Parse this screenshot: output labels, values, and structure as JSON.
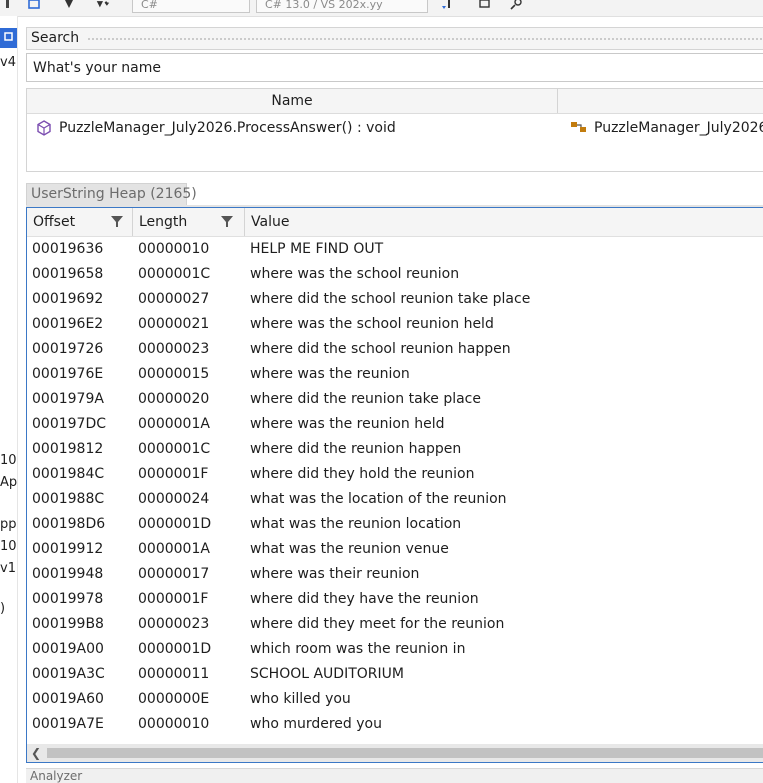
{
  "toolbar": {
    "language_select": "C#",
    "version_select": "C# 13.0 / VS 202x.yy"
  },
  "left_panel": {
    "fragments": [
      "v4.",
      "10.",
      "Ap",
      "pp",
      "10",
      "v1",
      ")"
    ]
  },
  "search": {
    "label": "Search",
    "value": "What's your name"
  },
  "results": {
    "column_name": "Name",
    "rows": [
      {
        "member": "PuzzleManager_July2026.ProcessAnswer() : void",
        "type": "PuzzleManager_July2026"
      }
    ]
  },
  "heap": {
    "tab_label": "UserString Heap (2165)",
    "columns": [
      "Offset",
      "Length",
      "Value"
    ],
    "rows": [
      {
        "offset": "00019636",
        "length": "00000010",
        "value": "HELP ME FIND OUT"
      },
      {
        "offset": "00019658",
        "length": "0000001C",
        "value": "where was the school reunion"
      },
      {
        "offset": "00019692",
        "length": "00000027",
        "value": "where did the school reunion take place"
      },
      {
        "offset": "000196E2",
        "length": "00000021",
        "value": "where was the school reunion held"
      },
      {
        "offset": "00019726",
        "length": "00000023",
        "value": "where did the school reunion happen"
      },
      {
        "offset": "0001976E",
        "length": "00000015",
        "value": "where was the reunion"
      },
      {
        "offset": "0001979A",
        "length": "00000020",
        "value": "where did the reunion take place"
      },
      {
        "offset": "000197DC",
        "length": "0000001A",
        "value": "where was the reunion held"
      },
      {
        "offset": "00019812",
        "length": "0000001C",
        "value": "where did the reunion happen"
      },
      {
        "offset": "0001984C",
        "length": "0000001F",
        "value": "where did they hold the reunion"
      },
      {
        "offset": "0001988C",
        "length": "00000024",
        "value": "what was the location of the reunion"
      },
      {
        "offset": "000198D6",
        "length": "0000001D",
        "value": "what was the reunion location"
      },
      {
        "offset": "00019912",
        "length": "0000001A",
        "value": "what was the reunion venue"
      },
      {
        "offset": "00019948",
        "length": "00000017",
        "value": "where was their reunion"
      },
      {
        "offset": "00019978",
        "length": "0000001F",
        "value": "where did they have the reunion"
      },
      {
        "offset": "000199B8",
        "length": "00000023",
        "value": "where did they meet for the reunion"
      },
      {
        "offset": "00019A00",
        "length": "0000001D",
        "value": "which room was the reunion in"
      },
      {
        "offset": "00019A3C",
        "length": "00000011",
        "value": "SCHOOL AUDITORIUM"
      },
      {
        "offset": "00019A60",
        "length": "0000000E",
        "value": "who killed you"
      },
      {
        "offset": "00019A7E",
        "length": "00000010",
        "value": "who murdered you"
      }
    ]
  },
  "bottom_panel": {
    "label": "Analyzer"
  },
  "colors": {
    "accent": "#3b78c6",
    "member_icon": "#7b4db0",
    "type_icon": "#c27c0e"
  }
}
